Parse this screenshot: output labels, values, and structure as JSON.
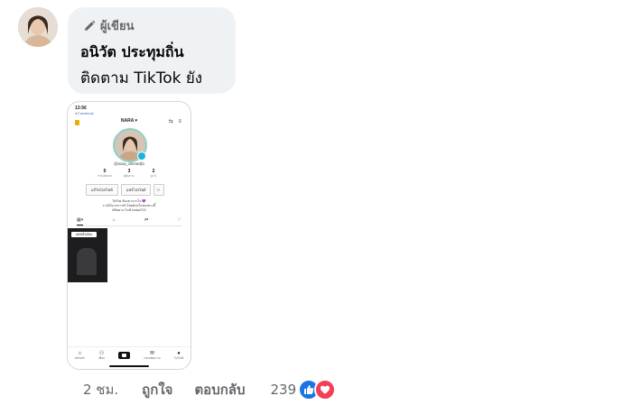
{
  "comment": {
    "badge_label": "ผู้เขียน",
    "author_name": "อนิวัต ประทุมถิ่น",
    "text": "ติดตาม TikTok ยัง"
  },
  "attachment": {
    "status_time": "13:56",
    "status_back": "◂ Facebook",
    "username": "NARA ▾",
    "handle": "@nara_ahmed(0",
    "stats": [
      {
        "value": "0",
        "label": "กำลังติดตาม"
      },
      {
        "value": "3",
        "label": "ผู้ติดตาม"
      },
      {
        "value": "2",
        "label": "ถูกใจ"
      }
    ],
    "buttons": [
      "แก้ไขโปรไฟล์",
      "แชร์โปรไฟล์"
    ],
    "bio_lines": [
      "TikTok ต้องมาจากใจ 💜",
      "รายได้จากการทำโพสต์ลงในช่องทางนี้",
      "#ติดตาม ไลฟ์ instanTIG"
    ],
    "video_label": "คลิปวิดีโอใหม่",
    "nav": [
      "หน้าหลัก",
      "เพื่อน",
      "",
      "กล่องข้อความ",
      "โปรไฟล์"
    ]
  },
  "actions": {
    "time": "2 ชม.",
    "like_label": "ถูกใจ",
    "reply_label": "ตอบกลับ",
    "reaction_count": "239"
  },
  "colors": {
    "bubble": "#eff2f5",
    "like_blue": "#1b74e4",
    "love_red": "#f33e58",
    "meta_gray": "#65676b"
  }
}
